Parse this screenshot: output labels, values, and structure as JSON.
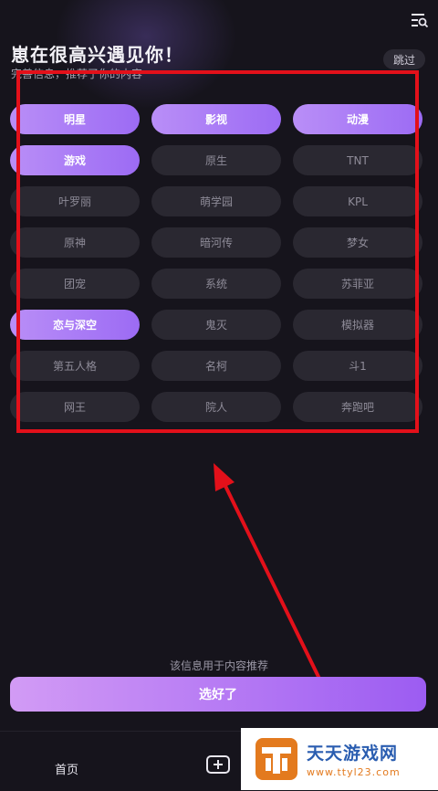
{
  "header": {
    "title": "崽在很高兴遇见你！",
    "subtitle": "完善信息，推荐了你的内容",
    "skip_label": "跳过",
    "menu_icon": "menu-search-icon"
  },
  "tags": [
    {
      "label": "明星",
      "selected": true
    },
    {
      "label": "影视",
      "selected": true
    },
    {
      "label": "动漫",
      "selected": true
    },
    {
      "label": "游戏",
      "selected": true
    },
    {
      "label": "原生",
      "selected": false
    },
    {
      "label": "TNT",
      "selected": false
    },
    {
      "label": "叶罗丽",
      "selected": false
    },
    {
      "label": "萌学园",
      "selected": false
    },
    {
      "label": "KPL",
      "selected": false
    },
    {
      "label": "原神",
      "selected": false
    },
    {
      "label": "暗河传",
      "selected": false
    },
    {
      "label": "梦女",
      "selected": false
    },
    {
      "label": "团宠",
      "selected": false
    },
    {
      "label": "系统",
      "selected": false
    },
    {
      "label": "苏菲亚",
      "selected": false
    },
    {
      "label": "恋与深空",
      "selected": true
    },
    {
      "label": "鬼灭",
      "selected": false
    },
    {
      "label": "模拟器",
      "selected": false
    },
    {
      "label": "第五人格",
      "selected": false
    },
    {
      "label": "名柯",
      "selected": false
    },
    {
      "label": "斗1",
      "selected": false
    },
    {
      "label": "网王",
      "selected": false
    },
    {
      "label": "院人",
      "selected": false
    },
    {
      "label": "奔跑吧",
      "selected": false
    }
  ],
  "footer": {
    "info_note": "该信息用于内容推荐",
    "confirm_label": "选好了"
  },
  "bottom_nav": {
    "home_label": "首页"
  },
  "watermark": {
    "title": "天天游戏网",
    "url": "www.ttyl23.com"
  },
  "colors": {
    "accent": "#a879f5",
    "annotation": "#e3101a"
  }
}
